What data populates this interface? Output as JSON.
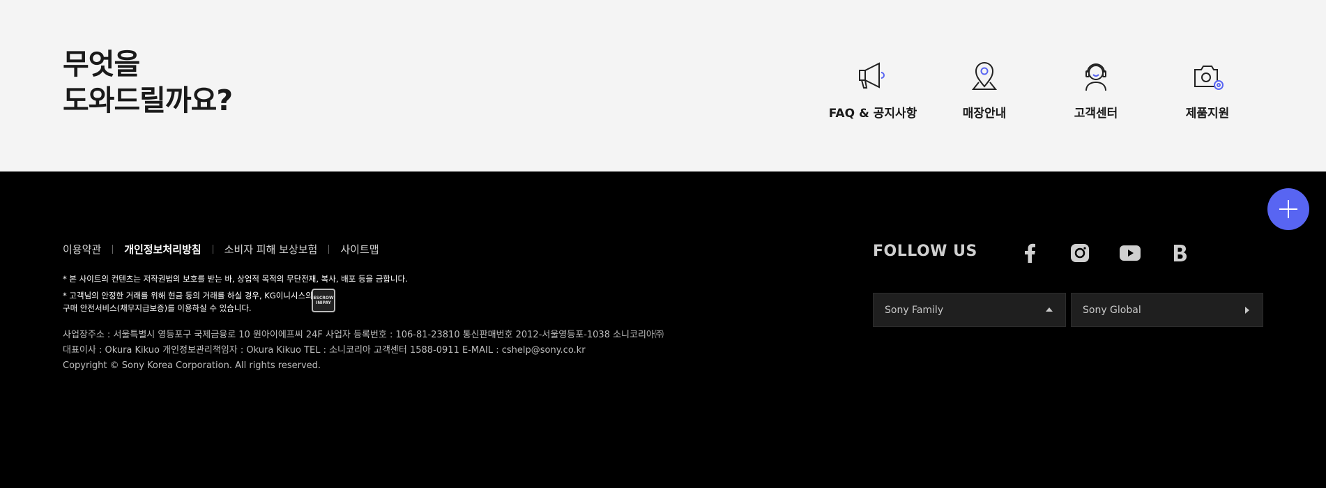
{
  "help": {
    "title_line1": "무엇을",
    "title_line2": "도와드릴까요?",
    "items": [
      {
        "label": "FAQ & 공지사항",
        "icon": "megaphone-icon"
      },
      {
        "label": "매장안내",
        "icon": "map-pin-icon"
      },
      {
        "label": "고객센터",
        "icon": "headset-agent-icon"
      },
      {
        "label": "제품지원",
        "icon": "camera-gear-icon"
      }
    ]
  },
  "footer": {
    "links": [
      {
        "label": "이용약관"
      },
      {
        "label": "개인정보처리방침"
      },
      {
        "label": "소비자 피해 보상보험"
      },
      {
        "label": "사이트맵"
      }
    ],
    "notice1": "* 본 사이트의 컨텐츠는 저작권법의 보호를 받는 바, 상업적 목적의 무단전재, 복사, 배포 등을 금합니다.",
    "notice2": "* 고객님의 안정한 거래를 위해 현금 등의 거래를 하실 경우, KG이니시스의 구매 안전서비스(채무지급보증)를 이용하실 수 있습니다.",
    "escrow_badge": "ESCROW INIPAY",
    "info_line1": "사업장주소 : 서울특별시 영등포구 국제금융로 10 원아이에프씨 24F 사업자 등록번호 : 106-81-23810 통신판매번호 2012-서울영등포-1038 소니코리아㈜",
    "info_line2": "대표이사 : Okura Kikuo 개인정보관리책임자 : Okura Kikuo TEL : 소니코리아 고객센터 1588-0911 E-MAIL : cshelp@sony.co.kr",
    "copyright": "Copyright © Sony Korea Corporation. All rights reserved.",
    "follow_us": "FOLLOW US",
    "social": [
      "facebook-icon",
      "instagram-icon",
      "youtube-icon",
      "blog-icon"
    ],
    "family_select": "Sony Family",
    "global_select": "Sony Global"
  },
  "colors": {
    "accent": "#5865f2",
    "help_bg": "#f4f4f4",
    "footer_bg": "#000000"
  }
}
